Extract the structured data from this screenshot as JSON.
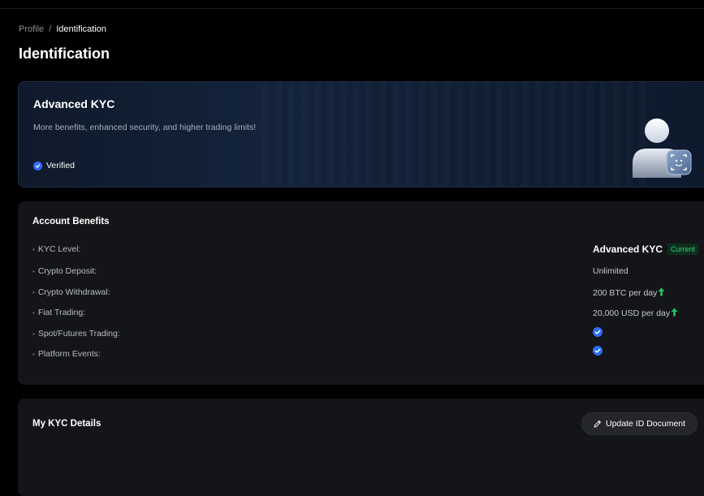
{
  "breadcrumb": {
    "parent": "Profile",
    "separator": "/",
    "current": "Identification"
  },
  "page": {
    "title": "Identification"
  },
  "hero": {
    "title": "Advanced KYC",
    "subtitle": "More benefits, enhanced security, and higher trading limits!",
    "status": "Verified",
    "illustration_icon": "user-face-scan-icon"
  },
  "benefits": {
    "title": "Account Benefits",
    "rows": [
      {
        "label": "KYC Level:",
        "value": "Advanced KYC",
        "badge": "Current"
      },
      {
        "label": "Crypto Deposit:",
        "value": "Unlimited"
      },
      {
        "label": "Crypto Withdrawal:",
        "value": "200 BTC per day",
        "icon": "arrow-up-icon"
      },
      {
        "label": "Fiat Trading:",
        "value": "20,000 USD per day",
        "icon": "arrow-up-icon"
      },
      {
        "label": "Spot/Futures Trading:",
        "icon": "check-circle-icon"
      },
      {
        "label": "Platform Events:",
        "icon": "check-circle-icon"
      }
    ]
  },
  "kyc_details": {
    "title": "My KYC Details",
    "update_button": "Update ID Document"
  },
  "colors": {
    "background": "#000000",
    "card": "#141518",
    "accent_blue": "#2f6bff",
    "success_green": "#22c55e"
  }
}
